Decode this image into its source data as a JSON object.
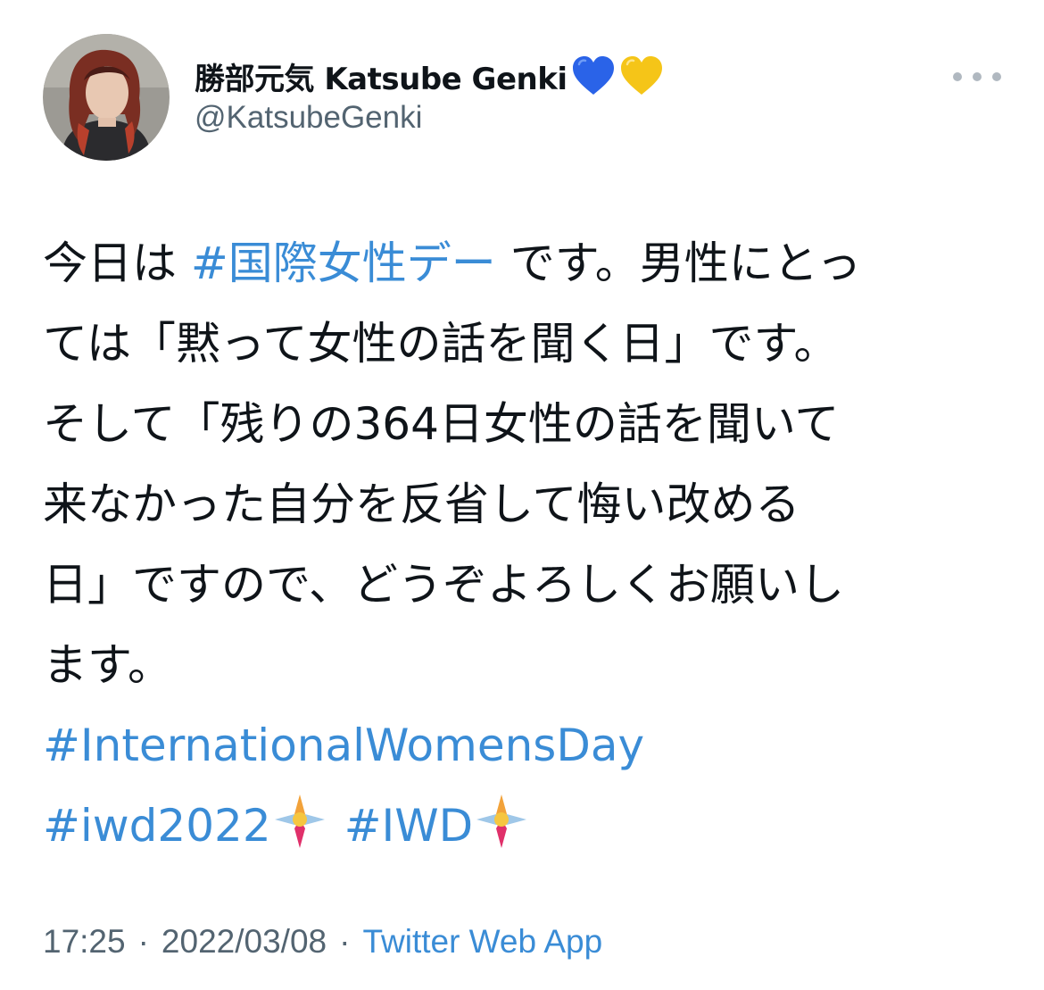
{
  "author": {
    "display_name": "勝部元気 Katsube Genki",
    "handle": "@KatsubeGenki",
    "name_emojis": [
      "blue-heart",
      "yellow-heart"
    ]
  },
  "tweet": {
    "lines": [
      {
        "text1": "今日は ",
        "tag": "#国際女性デー",
        "text2": " です。男性にとっ"
      },
      {
        "text": "ては「黙って女性の話を聞く日」です。"
      },
      {
        "text": "そして「残りの364日女性の話を聞いて"
      },
      {
        "text": "来なかった自分を反省して悔い改める"
      },
      {
        "text": "日」ですので、どうぞよろしくお願いし"
      },
      {
        "text": "ます。"
      }
    ],
    "hashtags": {
      "international": "#InternationalWomensDay",
      "iwd2022": "#iwd2022",
      "iwd": "#IWD"
    },
    "hashtag_emoji": "iwd-flower"
  },
  "meta": {
    "time": "17:25",
    "separator": "·",
    "date": "2022/03/08",
    "source": "Twitter Web App"
  },
  "colors": {
    "link": "#3a8cd6",
    "secondary_text": "#536471",
    "primary_text": "#0f1419",
    "blue_heart": "#2a63e8",
    "yellow_heart": "#f5c518"
  }
}
